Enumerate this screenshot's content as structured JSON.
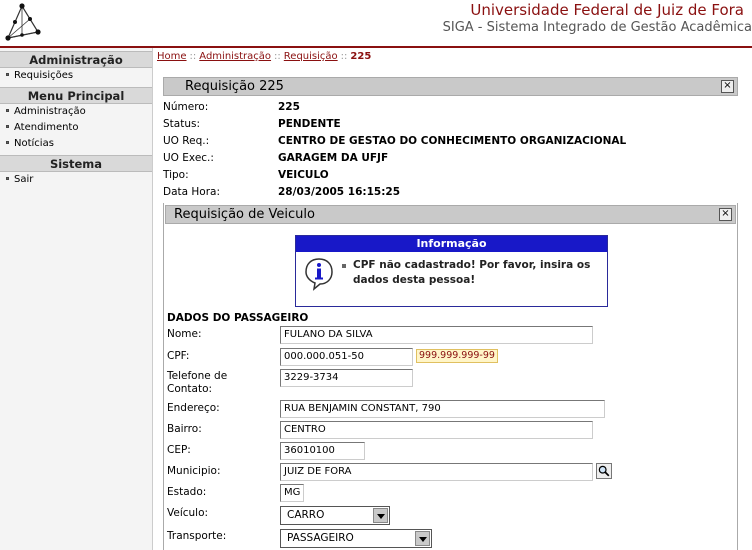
{
  "header": {
    "university": "Universidade Federal de Juiz de Fora",
    "system": "SIGA - Sistema Integrado de Gestão Acadêmica"
  },
  "sidebar": {
    "sections": [
      {
        "title": "Administração",
        "items": [
          "Requisições"
        ]
      },
      {
        "title": "Menu Principal",
        "items": [
          "Administração",
          "Atendimento",
          "Notícias"
        ]
      },
      {
        "title": "Sistema",
        "items": [
          "Sair"
        ]
      }
    ]
  },
  "breadcrumb": {
    "home": "Home",
    "admin": "Administração",
    "req": "Requisição",
    "current": "225",
    "separator": "::"
  },
  "panel": {
    "title": "Requisição 225",
    "close": "×",
    "fields": [
      {
        "label": "Número:",
        "value": "225"
      },
      {
        "label": "Status:",
        "value": "PENDENTE"
      },
      {
        "label": "UO Req.:",
        "value": "CENTRO DE GESTAO DO CONHECIMENTO ORGANIZACIONAL"
      },
      {
        "label": "UO Exec.:",
        "value": "GARAGEM DA UFJF"
      },
      {
        "label": "Tipo:",
        "value": "VEICULO"
      },
      {
        "label": "Data Hora:",
        "value": "28/03/2005 16:15:25"
      }
    ]
  },
  "subpanel": {
    "title": "Requisição de Veiculo",
    "close": "×"
  },
  "infobox": {
    "title": "Informação",
    "message": "CPF não cadastrado! Por favor, insira os dados desta pessoa!"
  },
  "form": {
    "section": "DADOS DO PASSAGEIRO",
    "nome_label": "Nome:",
    "nome": "FULANO DA SILVA",
    "cpf_label": "CPF:",
    "cpf": "000.000.051-50",
    "cpf_mask": "999.999.999-99",
    "telefone_label_1": "Telefone de",
    "telefone_label_2": "Contato:",
    "telefone": "3229-3734",
    "endereco_label": "Endereço:",
    "endereco": "RUA BENJAMIN CONSTANT, 790",
    "bairro_label": "Bairro:",
    "bairro": "CENTRO",
    "cep_label": "CEP:",
    "cep": "36010100",
    "municipio_label": "Municipio:",
    "municipio": "JUIZ DE FORA",
    "estado_label": "Estado:",
    "estado": "MG",
    "veiculo_label": "Veículo:",
    "veiculo": "CARRO",
    "transporte_label": "Transporte:",
    "transporte": "PASSAGEIRO"
  },
  "colors": {
    "brand": "#8a1010",
    "info_header": "#1818c8",
    "panel_title_bg": "#c9c9c9"
  }
}
